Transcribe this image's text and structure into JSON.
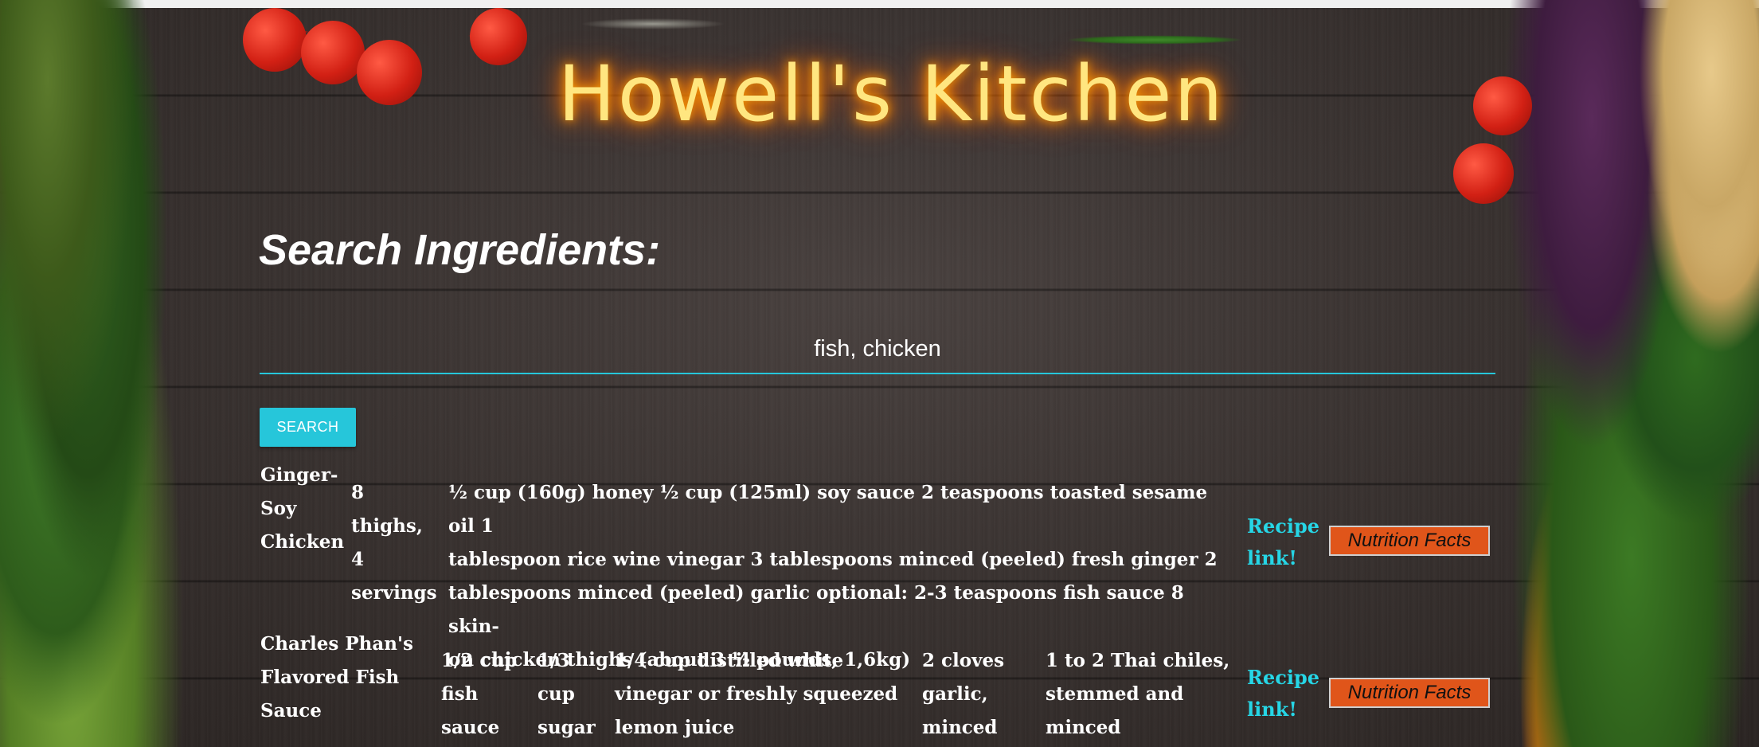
{
  "app": {
    "title": "Howell's Kitchen"
  },
  "search": {
    "heading": "Search Ingredients:",
    "value": "fish, chicken",
    "button_label": "SEARCH"
  },
  "results": [
    {
      "name": "Ginger-Soy Chicken",
      "name_lines": [
        "Ginger-",
        "Soy",
        "Chicken"
      ],
      "yield_lines": [
        "8",
        "thighs,",
        "4",
        "servings"
      ],
      "ingredient_lines": [
        "½ cup (160g) honey ½ cup (125ml) soy sauce 2 teaspoons toasted sesame oil 1",
        "tablespoon rice wine vinegar 3 tablespoons minced (peeled) fresh ginger 2",
        "tablespoons minced (peeled) garlic optional: 2-3 teaspoons fish sauce 8 skin-",
        "on chicken thighs (about 3 ½ pounds, 1,6kg)"
      ],
      "link_lines": [
        "Recipe",
        "link!"
      ],
      "nutrition_label": "Nutrition Facts"
    },
    {
      "name": "Charles Phan's Flavored Fish Sauce",
      "name_lines": [
        "Charles Phan's",
        "Flavored Fish",
        "Sauce"
      ],
      "ingredient_columns": [
        [
          "1/2 cup",
          "fish",
          "sauce"
        ],
        [
          "1/3",
          "cup",
          "sugar"
        ],
        [
          "1/4 cup distilled white",
          "vinegar or freshly squeezed",
          "lemon juice"
        ],
        [
          "2 cloves",
          "garlic,",
          "minced"
        ],
        [
          "1 to 2 Thai chiles,",
          "stemmed and",
          "minced"
        ]
      ],
      "link_lines": [
        "Recipe",
        "link!"
      ],
      "nutrition_label": "Nutrition Facts"
    }
  ]
}
